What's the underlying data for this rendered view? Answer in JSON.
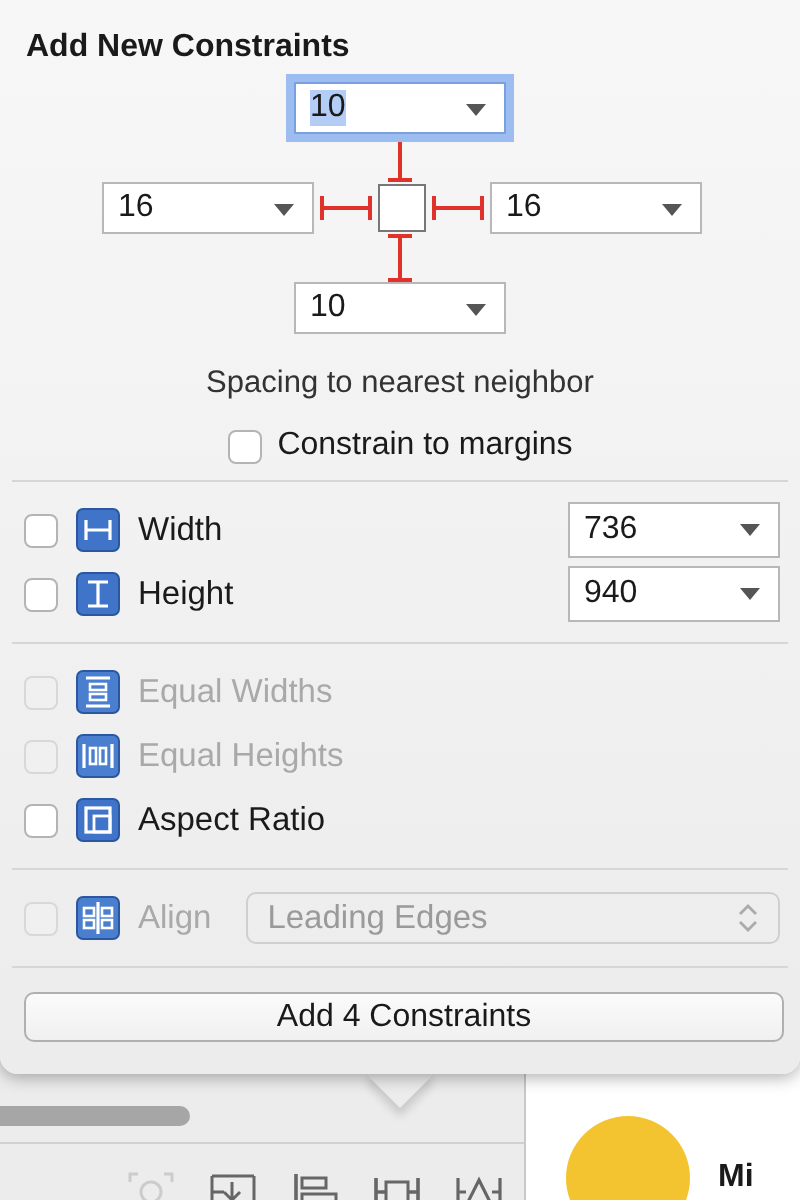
{
  "title": "Add New Constraints",
  "spacing": {
    "top": {
      "value": "10",
      "selected": true
    },
    "left": {
      "value": "16",
      "selected": false
    },
    "right": {
      "value": "16",
      "selected": false
    },
    "bottom": {
      "value": "10",
      "selected": false
    },
    "caption": "Spacing to nearest neighbor"
  },
  "constrain_to_margins": {
    "label": "Constrain to margins",
    "checked": false
  },
  "size_constraints": [
    {
      "kind": "width",
      "label": "Width",
      "checked": false,
      "value": "736"
    },
    {
      "kind": "height",
      "label": "Height",
      "checked": false,
      "value": "940"
    }
  ],
  "relation_constraints": [
    {
      "kind": "equal-widths",
      "label": "Equal Widths",
      "checked": false,
      "disabled": true
    },
    {
      "kind": "equal-heights",
      "label": "Equal Heights",
      "checked": false,
      "disabled": true
    },
    {
      "kind": "aspect-ratio",
      "label": "Aspect Ratio",
      "checked": false,
      "disabled": false
    }
  ],
  "align": {
    "label": "Align",
    "checked": false,
    "disabled": true,
    "option": "Leading Edges"
  },
  "add_button": "Add 4 Constraints",
  "canvas": {
    "label": "Mi"
  }
}
